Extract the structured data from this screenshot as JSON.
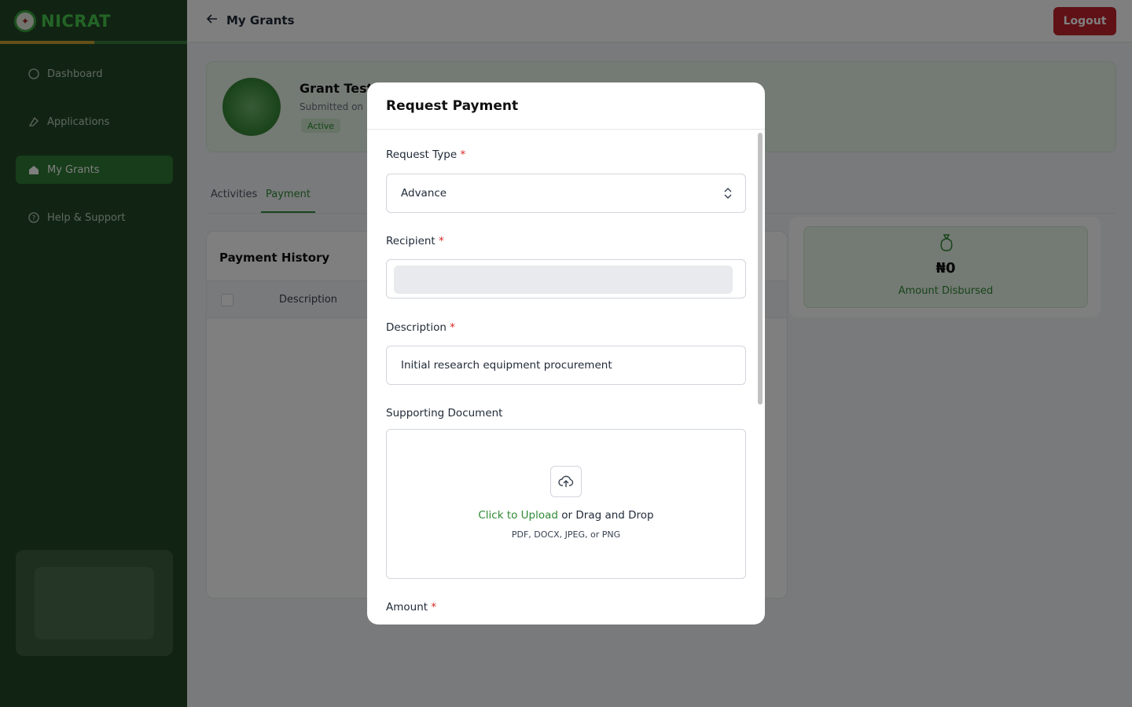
{
  "app": {
    "logo_text": "NICRAT"
  },
  "sidebar": {
    "items": [
      {
        "label": "Dashboard",
        "icon": "dashboard-icon"
      },
      {
        "label": "Applications",
        "icon": "applications-icon"
      },
      {
        "label": "My Grants",
        "icon": "grants-icon"
      },
      {
        "label": "Help & Support",
        "icon": "help-icon"
      }
    ]
  },
  "header": {
    "back_label": "My Grants",
    "logout_label": "Logout"
  },
  "grant": {
    "title": "Grant Test I",
    "subtitle": "Submitted on",
    "status": "Active"
  },
  "tabs": [
    {
      "label": "Activities"
    },
    {
      "label": "Payment"
    }
  ],
  "payment_history": {
    "title": "Payment History",
    "columns": [
      "Description"
    ]
  },
  "disbursed": {
    "value": "₦0",
    "label": "Amount Disbursed"
  },
  "modal": {
    "title": "Request Payment",
    "request_type": {
      "label": "Request Type",
      "required_mark": "*",
      "value": "Advance"
    },
    "recipient": {
      "label": "Recipient",
      "required_mark": "*"
    },
    "description": {
      "label": "Description",
      "required_mark": "*",
      "value": "Initial research equipment procurement"
    },
    "supporting_document": {
      "label": "Supporting Document",
      "upload_link": "Click to Upload",
      "upload_rest": " or Drag and Drop",
      "hint": "PDF, DOCX, JPEG, or PNG"
    },
    "amount": {
      "label": "Amount",
      "required_mark": "*"
    }
  },
  "colors": {
    "sidebar_bg": "#234827",
    "accent_green": "#2f8a34",
    "logout_red": "#c0222b",
    "required_red": "#dc2626"
  }
}
